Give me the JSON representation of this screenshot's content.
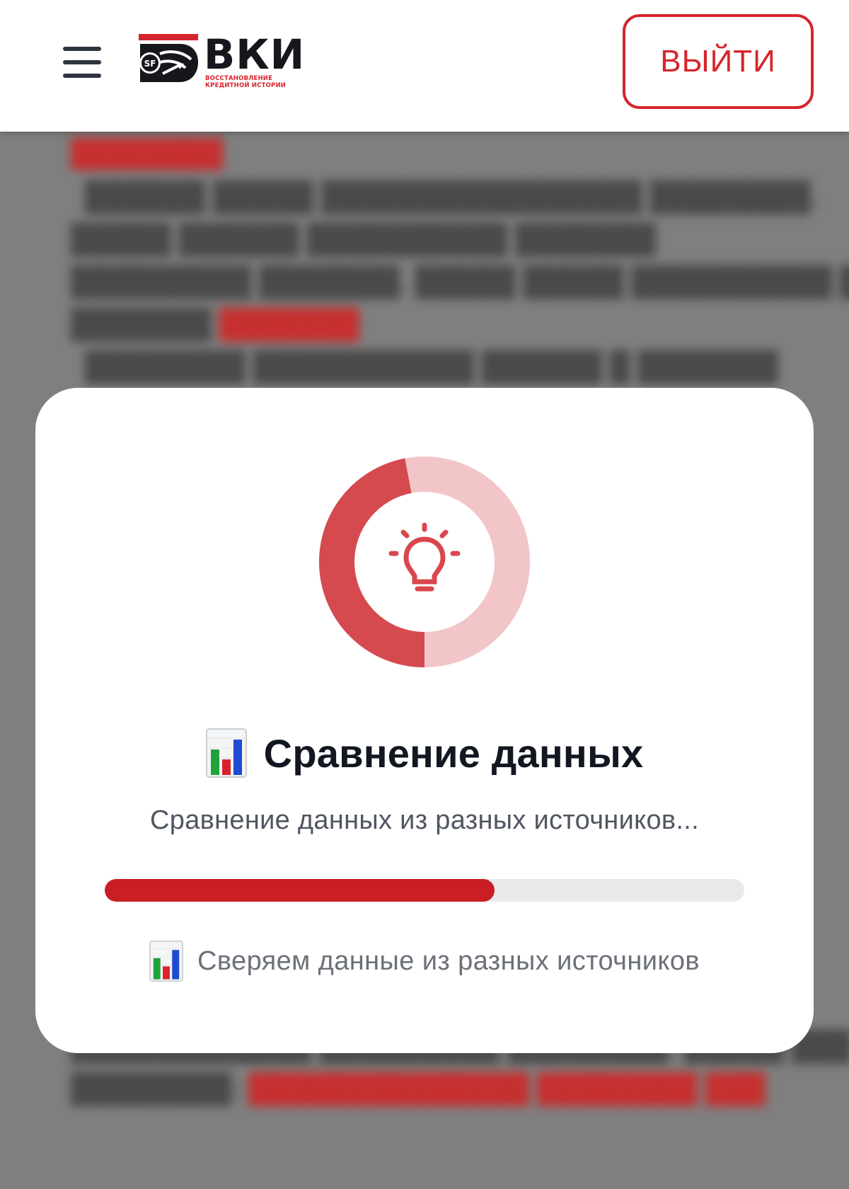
{
  "header": {
    "logo": {
      "brand": "ВКИ",
      "mark_text": "SF",
      "tagline": "ВОССТАНОВЛЕНИЕ КРЕДИТНОЙ ИСТОРИИ"
    },
    "logout_label": "ВЫЙТИ"
  },
  "modal": {
    "icon": "lightbulb-icon",
    "title_emoji": "bar-chart-icon",
    "title": "Сравнение данных",
    "subtitle": "Сравнение данных из разных источников...",
    "ring_progress": 0.47,
    "progress_percent": 61,
    "step_emoji": "bar-chart-icon",
    "step_text": "Сверяем данные из разных источников"
  },
  "colors": {
    "accent": "#d6252c",
    "progress_fill": "#c81e24",
    "ring_fill": "#d44a4f",
    "ring_track": "#f2c6c8"
  }
}
